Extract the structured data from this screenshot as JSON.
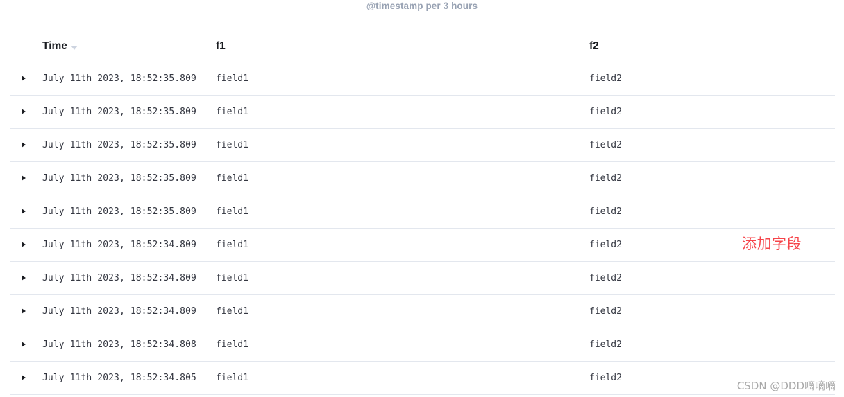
{
  "chart": {
    "caption": "@timestamp per 3 hours"
  },
  "table": {
    "columns": [
      {
        "key": "time",
        "label": "Time",
        "sort": "desc",
        "sort_icon": "chevron-down-icon"
      },
      {
        "key": "f1",
        "label": "f1"
      },
      {
        "key": "f2",
        "label": "f2"
      }
    ],
    "expand_icon": "caret-right-icon",
    "rows": [
      {
        "time": "July 11th 2023, 18:52:35.809",
        "f1": "field1",
        "f2": "field2"
      },
      {
        "time": "July 11th 2023, 18:52:35.809",
        "f1": "field1",
        "f2": "field2"
      },
      {
        "time": "July 11th 2023, 18:52:35.809",
        "f1": "field1",
        "f2": "field2"
      },
      {
        "time": "July 11th 2023, 18:52:35.809",
        "f1": "field1",
        "f2": "field2"
      },
      {
        "time": "July 11th 2023, 18:52:35.809",
        "f1": "field1",
        "f2": "field2"
      },
      {
        "time": "July 11th 2023, 18:52:34.809",
        "f1": "field1",
        "f2": "field2"
      },
      {
        "time": "July 11th 2023, 18:52:34.809",
        "f1": "field1",
        "f2": "field2"
      },
      {
        "time": "July 11th 2023, 18:52:34.809",
        "f1": "field1",
        "f2": "field2"
      },
      {
        "time": "July 11th 2023, 18:52:34.808",
        "f1": "field1",
        "f2": "field2"
      },
      {
        "time": "July 11th 2023, 18:52:34.805",
        "f1": "field1",
        "f2": "field2"
      }
    ]
  },
  "annotation": {
    "text": "添加字段",
    "color": "#f6444a"
  },
  "watermark": {
    "text": "CSDN @DDD嘀嘀嘀"
  }
}
